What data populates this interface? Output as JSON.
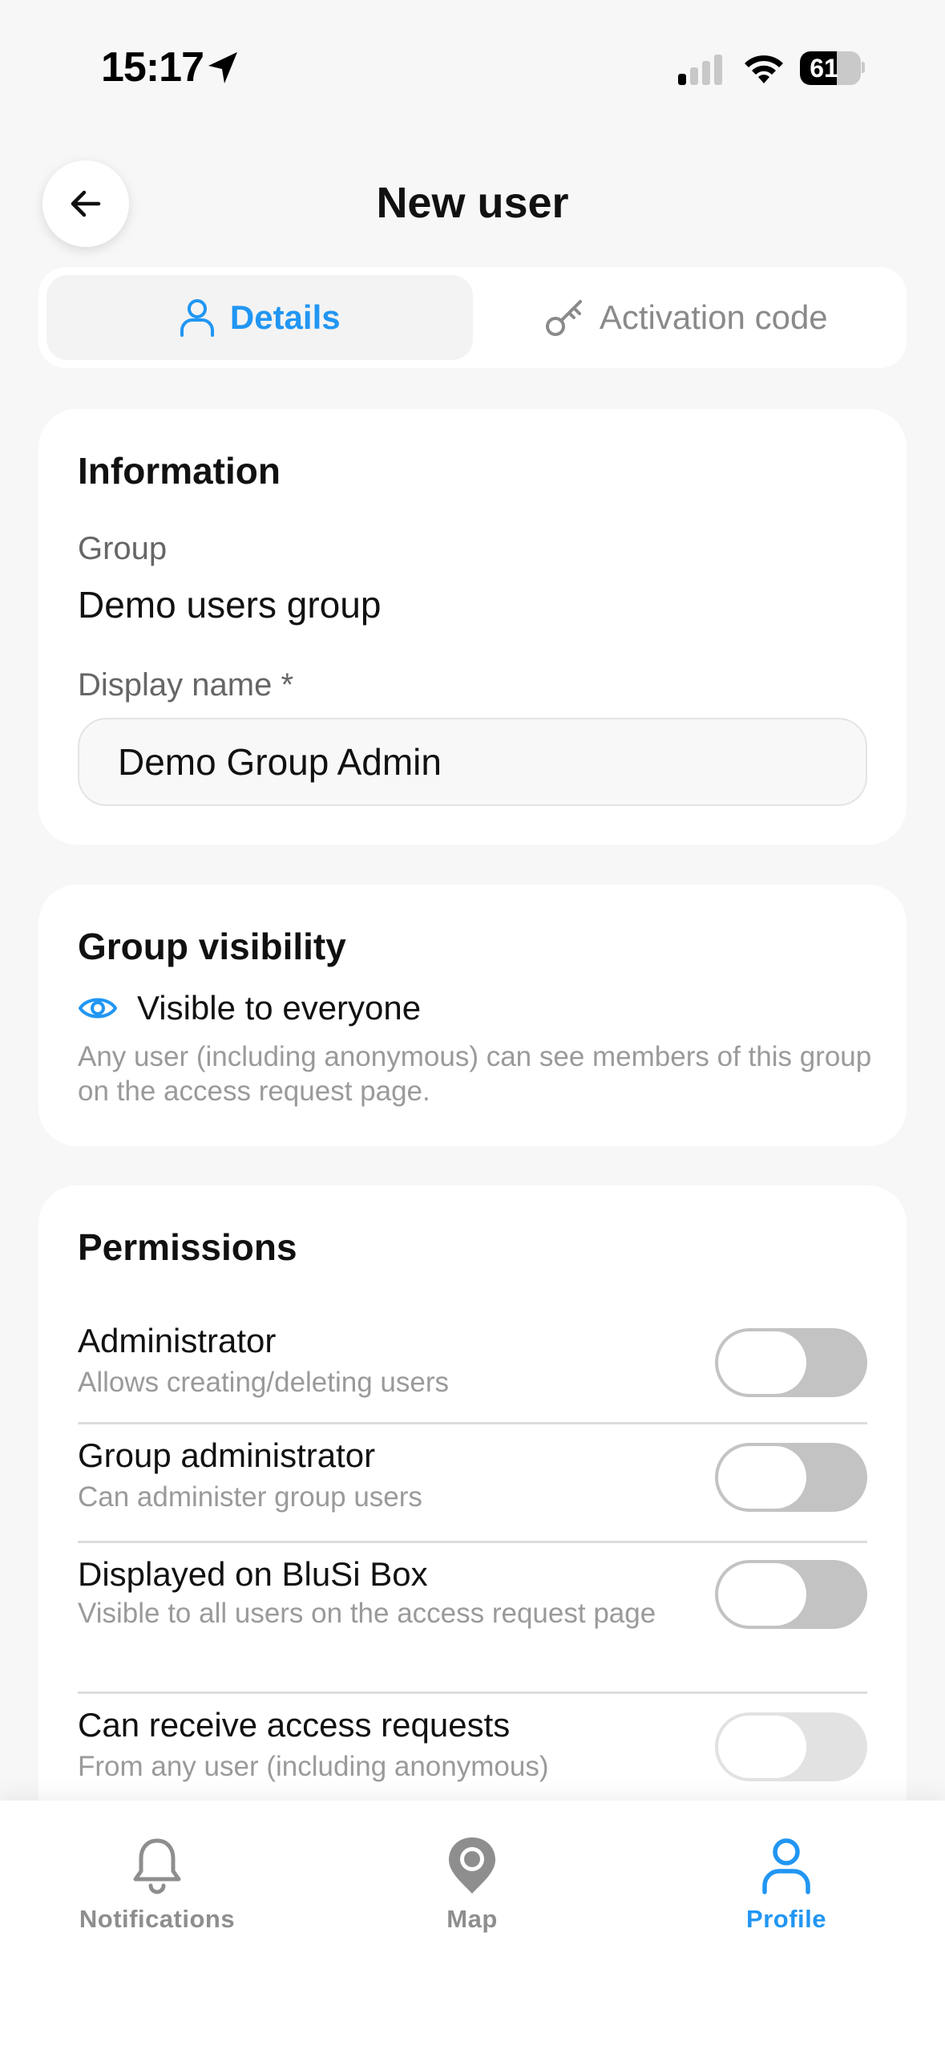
{
  "status_bar": {
    "time": "15:17",
    "battery": "61",
    "battery_level": 0.61
  },
  "header": {
    "title": "New user",
    "back_icon": "arrow-left-icon"
  },
  "tabs": [
    {
      "label": "Details",
      "icon": "user-icon",
      "active": true
    },
    {
      "label": "Activation code",
      "icon": "key-icon",
      "active": false
    }
  ],
  "information": {
    "heading": "Information",
    "group_label": "Group",
    "group_value": "Demo users group",
    "display_name_label": "Display name *",
    "display_name_value": "Demo Group Admin"
  },
  "visibility": {
    "heading": "Group visibility",
    "icon": "eye-icon",
    "label": "Visible to everyone",
    "description": "Any user (including anonymous) can see members of this group on the access request page."
  },
  "permissions": {
    "heading": "Permissions",
    "items": [
      {
        "title": "Administrator",
        "description": "Allows creating/deleting users",
        "enabled": false
      },
      {
        "title": "Group administrator",
        "description": "Can administer group users",
        "enabled": false
      },
      {
        "title": "Displayed on BluSi Box",
        "description": "Visible to all users on the access request page",
        "enabled": false
      },
      {
        "title": "Can receive access requests",
        "description": "From any user (including anonymous)",
        "enabled": false
      }
    ]
  },
  "bottom_nav": [
    {
      "label": "Notifications",
      "icon": "bell-icon",
      "active": false
    },
    {
      "label": "Map",
      "icon": "map-pin-icon",
      "active": false
    },
    {
      "label": "Profile",
      "icon": "user-icon",
      "active": true
    }
  ],
  "colors": {
    "accent": "#2196f3",
    "background": "#f7f7f7",
    "muted_text": "#9a9a9a",
    "toggle_off": "#c3c3c3"
  }
}
